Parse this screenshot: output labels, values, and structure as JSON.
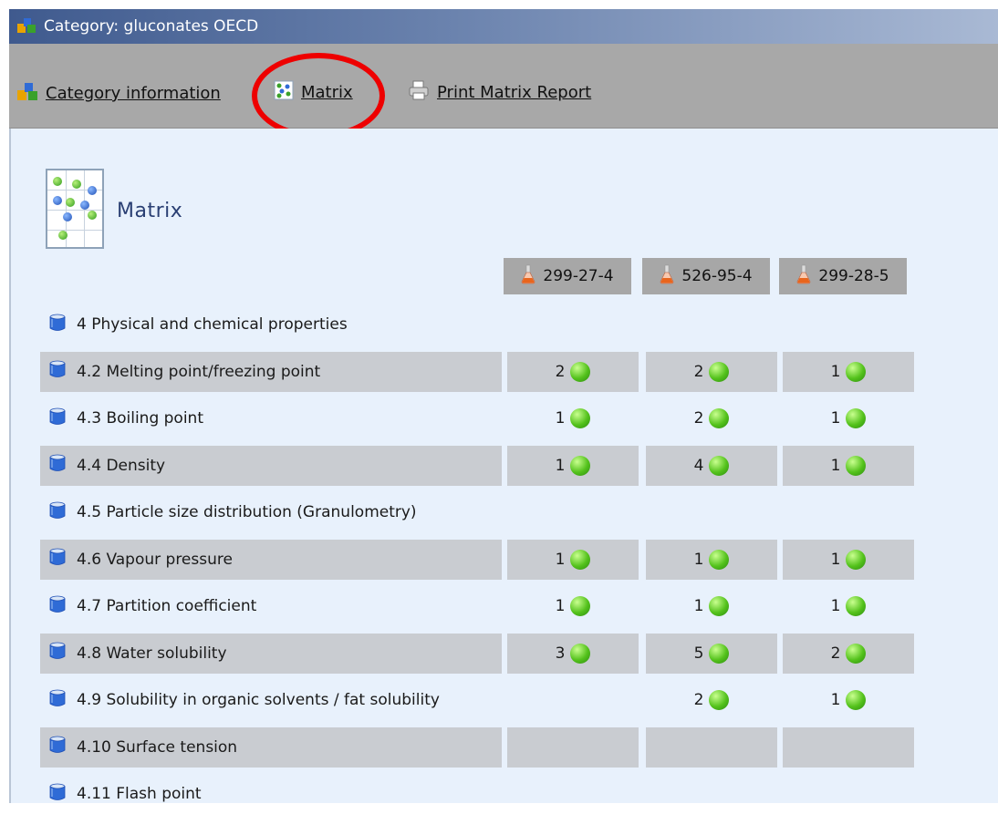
{
  "window": {
    "title": "Category: gluconates OECD"
  },
  "toolbar": {
    "category_info": "Category information",
    "matrix": "Matrix",
    "print_report": "Print Matrix Report"
  },
  "heading": "Matrix",
  "columns": [
    "299-27-4",
    "526-95-4",
    "299-28-5"
  ],
  "rows": [
    {
      "label": "4 Physical and chemical properties",
      "values": [
        "",
        "",
        ""
      ],
      "group": true
    },
    {
      "label": "4.2 Melting point/freezing point",
      "values": [
        "2",
        "2",
        "1"
      ]
    },
    {
      "label": "4.3 Boiling point",
      "values": [
        "1",
        "2",
        "1"
      ]
    },
    {
      "label": "4.4 Density",
      "values": [
        "1",
        "4",
        "1"
      ]
    },
    {
      "label": "4.5 Particle size distribution (Granulometry)",
      "values": [
        "",
        "",
        ""
      ],
      "group": true
    },
    {
      "label": "4.6 Vapour pressure",
      "values": [
        "1",
        "1",
        "1"
      ]
    },
    {
      "label": "4.7 Partition coefficient",
      "values": [
        "1",
        "1",
        "1"
      ]
    },
    {
      "label": "4.8 Water solubility",
      "values": [
        "3",
        "5",
        "2"
      ]
    },
    {
      "label": "4.9 Solubility in organic solvents / fat solubility",
      "values": [
        "",
        "2",
        "1"
      ]
    },
    {
      "label": "4.10 Surface tension",
      "values": [
        "",
        "",
        ""
      ]
    },
    {
      "label": "4.11 Flash point",
      "values": [
        "",
        "",
        ""
      ],
      "group": true
    }
  ],
  "colors": {
    "highlight": "#ee0000",
    "status_ok": "#54c21c"
  }
}
